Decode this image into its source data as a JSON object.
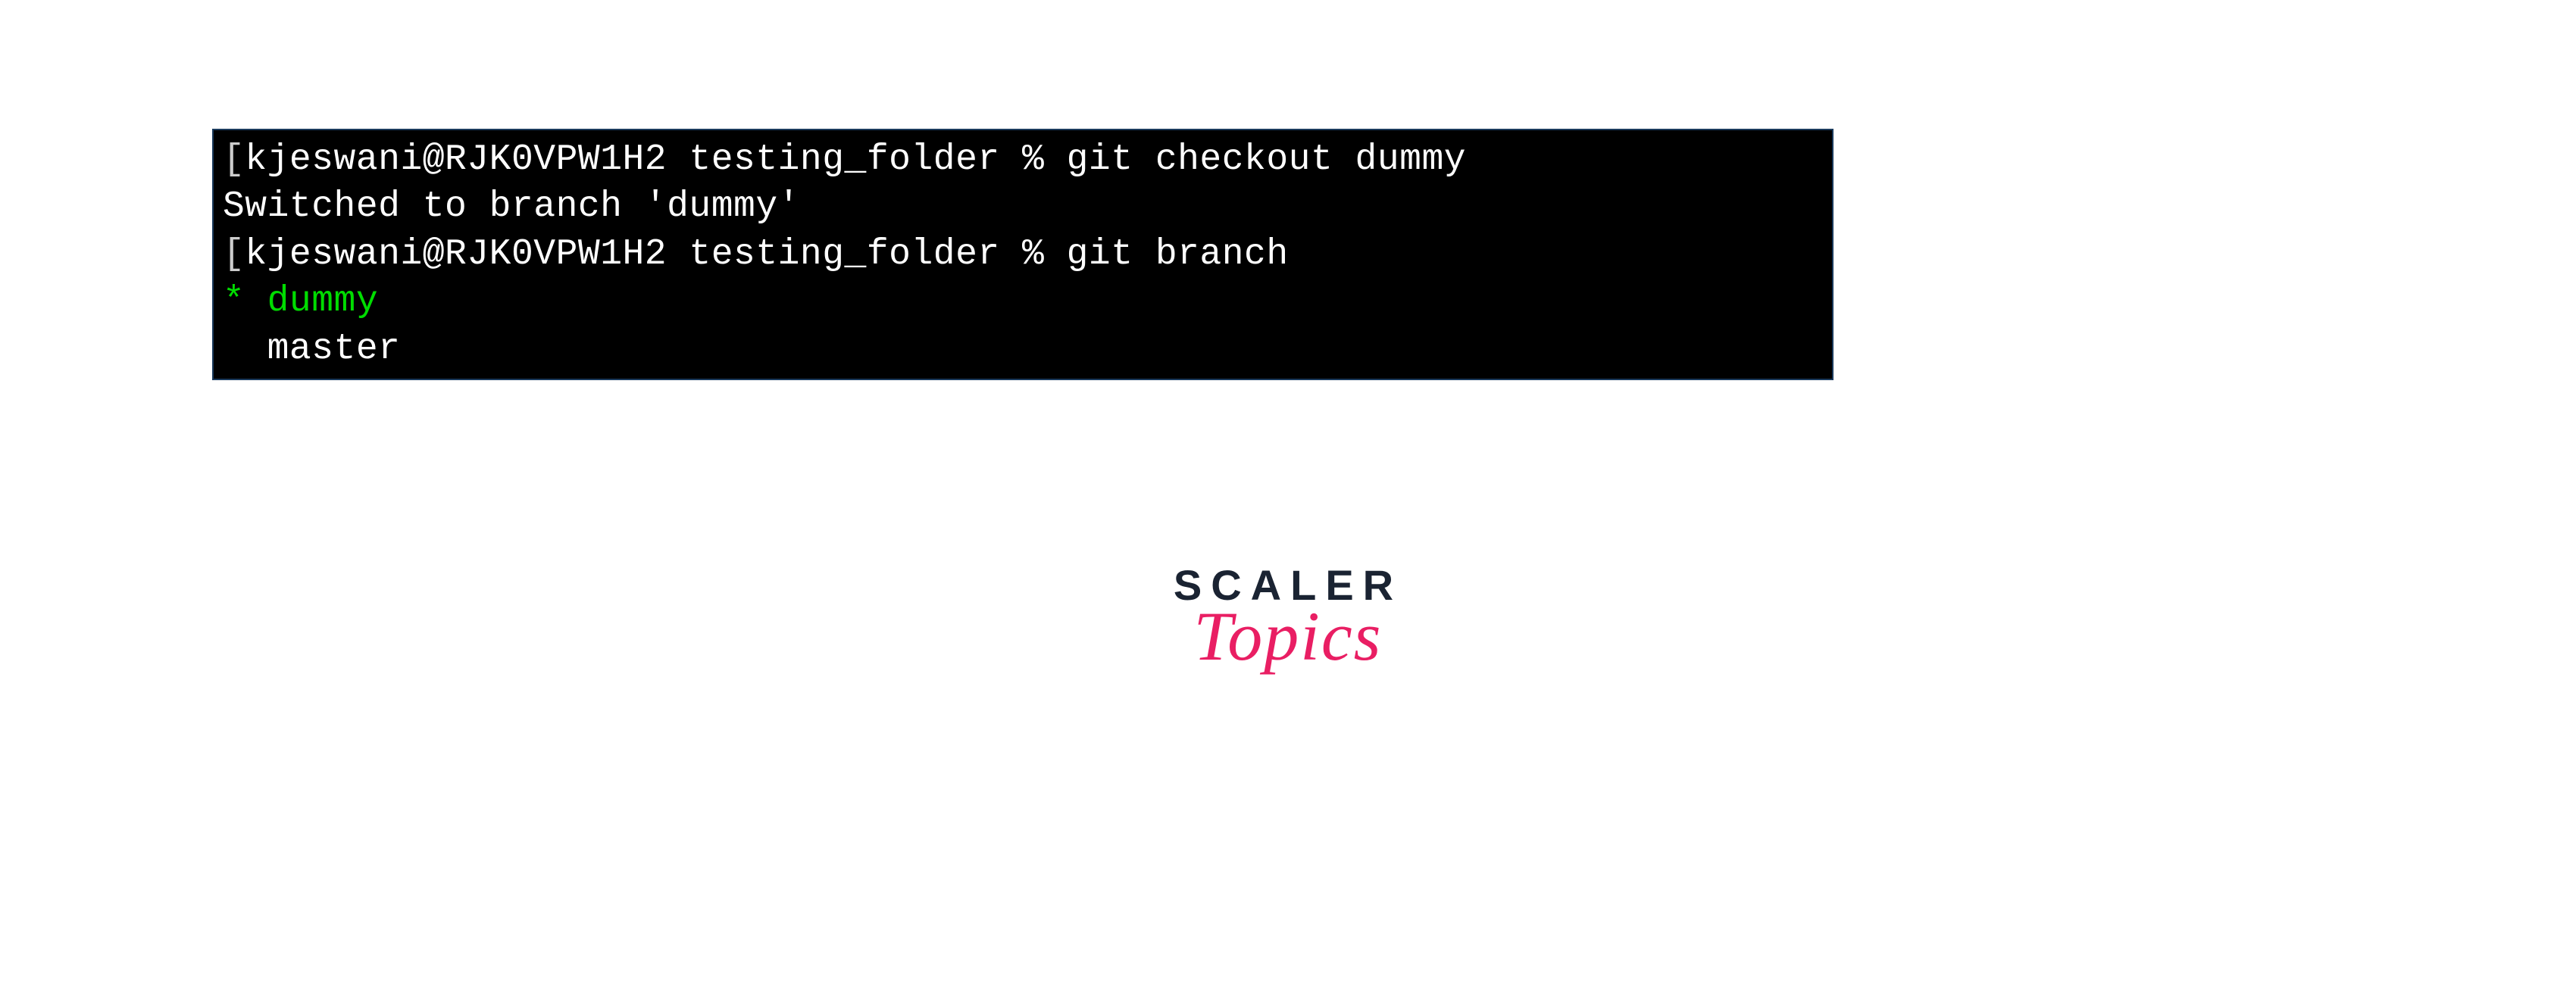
{
  "terminal": {
    "lines": [
      {
        "bracket": "[",
        "prompt": "kjeswani@RJK0VPW1H2 testing_folder % ",
        "command": "git checkout dummy"
      },
      {
        "output": "Switched to branch 'dummy'"
      },
      {
        "bracket": "[",
        "prompt": "kjeswani@RJK0VPW1H2 testing_folder % ",
        "command": "git branch"
      },
      {
        "marker": "* ",
        "branch": "dummy",
        "current": true
      },
      {
        "marker": "  ",
        "branch": "master",
        "current": false
      }
    ]
  },
  "logo": {
    "line1": "SCALER",
    "line2": "Topics"
  }
}
